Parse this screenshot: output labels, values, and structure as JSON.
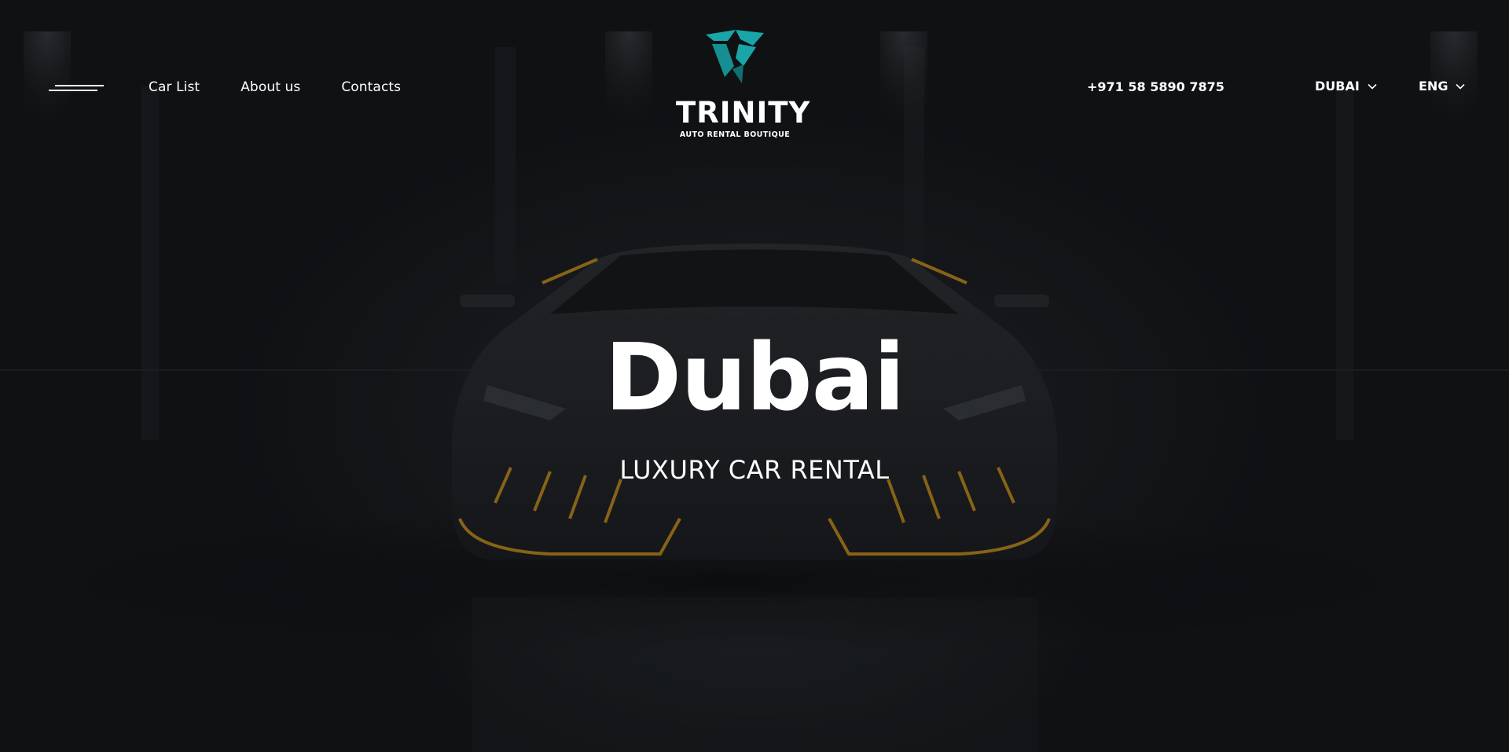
{
  "colors": {
    "brand_teal": "#1aa6a8",
    "text": "#ffffff",
    "background": "#141619",
    "car_accent": "#c9921c"
  },
  "header": {
    "menu_icon": "menu-lines-icon",
    "nav": [
      {
        "label": "Car List"
      },
      {
        "label": "About us"
      },
      {
        "label": "Contacts"
      }
    ],
    "logo": {
      "icon": "trinity-logo-icon",
      "wordmark": "TRINITY",
      "tagline": "AUTO RENTAL BOUTIQUE"
    },
    "phone": "+971 58 5890 7875",
    "city_select": {
      "value": "DUBAI",
      "icon": "chevron-down-icon"
    },
    "lang_select": {
      "value": "ENG",
      "icon": "chevron-down-icon"
    }
  },
  "hero": {
    "title": "Dubai",
    "subtitle": "LUXURY CAR RENTAL",
    "background_image": "dark-supercar-garage"
  }
}
